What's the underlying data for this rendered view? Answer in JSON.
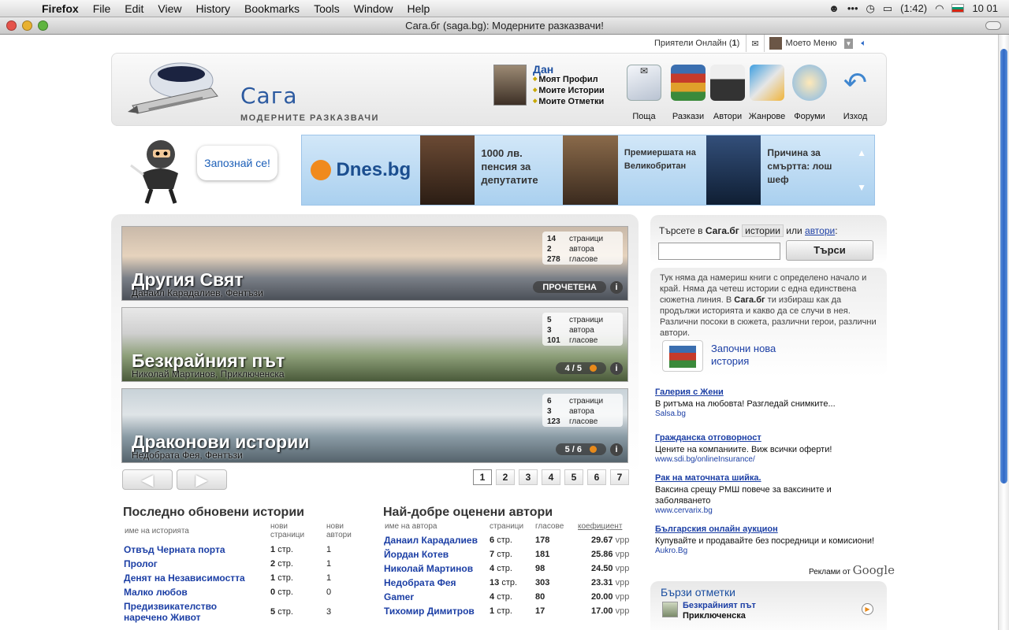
{
  "menubar": {
    "app": "Firefox",
    "items": [
      "File",
      "Edit",
      "View",
      "History",
      "Bookmarks",
      "Tools",
      "Window",
      "Help"
    ],
    "battery": "(1:42)",
    "clock": "10 01"
  },
  "window": {
    "title": "Сага.бг (saga.bg): Модерните разказвачи!"
  },
  "topstrip": {
    "friends_label": "Приятели Онлайн (",
    "friends_count": "1",
    "friends_close": ")",
    "my_menu": "Моето Меню"
  },
  "header": {
    "logo_text": "Сага",
    "logo_sub": "МОДЕРНИТЕ РАЗКАЗВАЧИ",
    "user_name": "Дан",
    "user_links": [
      "Моят Профил",
      "Моите Истории",
      "Моите Отметки"
    ],
    "nav": [
      "Поща",
      "Разкази",
      "Автори",
      "Жанрове",
      "Форуми",
      "Изход"
    ]
  },
  "promo": {
    "zapoznai": "Запознай се!"
  },
  "banner": {
    "brand": "Dnes.bg",
    "items": [
      "1000 лв. пенсия за депутатите",
      "Премиершата на Великобритан",
      "Причина за смъртта: лош шеф"
    ]
  },
  "stories": [
    {
      "title": "Другия Свят",
      "author": "Данаил Карадалиев, Фентъзи",
      "pages": "14",
      "authors": "2",
      "votes": "278",
      "badge": "ПРОЧЕТЕНА"
    },
    {
      "title": "Безкрайният път",
      "author": "Николай Мартинов, Приключенска",
      "pages": "5",
      "authors": "3",
      "votes": "101",
      "badge": "4 / 5"
    },
    {
      "title": "Драконови истории",
      "author": "Недобрата Фея, Фентъзи",
      "pages": "6",
      "authors": "3",
      "votes": "123",
      "badge": "5 / 6"
    }
  ],
  "stats_labels": {
    "pages": "страници",
    "authors": "автора",
    "votes": "гласове"
  },
  "pagination": [
    "1",
    "2",
    "3",
    "4",
    "5",
    "6",
    "7"
  ],
  "recent": {
    "heading": "Последно обновени истории",
    "col_name": "име на историята",
    "col_pages": "нови страници",
    "col_authors": "нови автори",
    "unit": "стр.",
    "rows": [
      {
        "name": "Отвъд Черната порта",
        "pages": "1",
        "authors": "1"
      },
      {
        "name": "Пролог",
        "pages": "2",
        "authors": "1"
      },
      {
        "name": "Денят на Независимостта",
        "pages": "1",
        "authors": "1"
      },
      {
        "name": "Малко любов",
        "pages": "0",
        "authors": "0"
      },
      {
        "name": "Предизвикателство наречено Живот",
        "pages": "5",
        "authors": "3"
      }
    ]
  },
  "top_authors": {
    "heading": "Най-добре оценени автори",
    "col_name": "име на автора",
    "col_pages": "страници",
    "col_votes": "гласове",
    "col_coef": "коефициент",
    "unit": "стр.",
    "coef_unit": "vpp",
    "rows": [
      {
        "name": "Данаил Карадалиев",
        "pages": "6",
        "votes": "178",
        "coef": "29.67"
      },
      {
        "name": "Йордан Котев",
        "pages": "7",
        "votes": "181",
        "coef": "25.86"
      },
      {
        "name": "Николай Мартинов",
        "pages": "4",
        "votes": "98",
        "coef": "24.50"
      },
      {
        "name": "Недобрата Фея",
        "pages": "13",
        "votes": "303",
        "coef": "23.31"
      },
      {
        "name": "Gamer",
        "pages": "4",
        "votes": "80",
        "coef": "20.00"
      },
      {
        "name": "Тихомир Димитров",
        "pages": "1",
        "votes": "17",
        "coef": "17.00"
      }
    ]
  },
  "search": {
    "label_pre": "Търсете в ",
    "label_site": "Сага.бг",
    "tag_stories": "истории",
    "label_or": " или ",
    "link_authors": "автори",
    "label_colon": ":",
    "button": "Търси"
  },
  "about": {
    "text_pre": "Тук няма да намериш книги с определено начало и край. Няма да четеш истории с една единствена сюжетна линия. В ",
    "site": "Сага.бг",
    "text_post": " ти избираш как да продължи историята и какво да се случи в нея. Различни посоки в сюжета, различни герои, различни автори.",
    "new_story": "Започни нова история"
  },
  "ads": [
    {
      "title": "Галерия с Жени",
      "desc": "В ритъма на любовта! Разгледай снимките...",
      "url": "Salsa.bg"
    },
    {
      "title": "Гражданска отговорност",
      "desc": "Цените на компаниите. Виж всички оферти!",
      "url": "www.sdi.bg/onlineInsurance/"
    },
    {
      "title": "Рак на маточната шийка.",
      "desc": "Ваксина срещу РМШ повече за ваксините и заболяването",
      "url": "www.cervarix.bg"
    },
    {
      "title": "Българския онлайн аукцион",
      "desc": "Купувайте и продавайте без посредници и комисиони!",
      "url": "Aukro.Bg"
    }
  ],
  "ads_by": {
    "label": "Реклами от ",
    "brand": "Google"
  },
  "quick": {
    "heading": "Бързи отметки",
    "item_title": "Безкрайният път",
    "item_genre": "Приключенска"
  }
}
